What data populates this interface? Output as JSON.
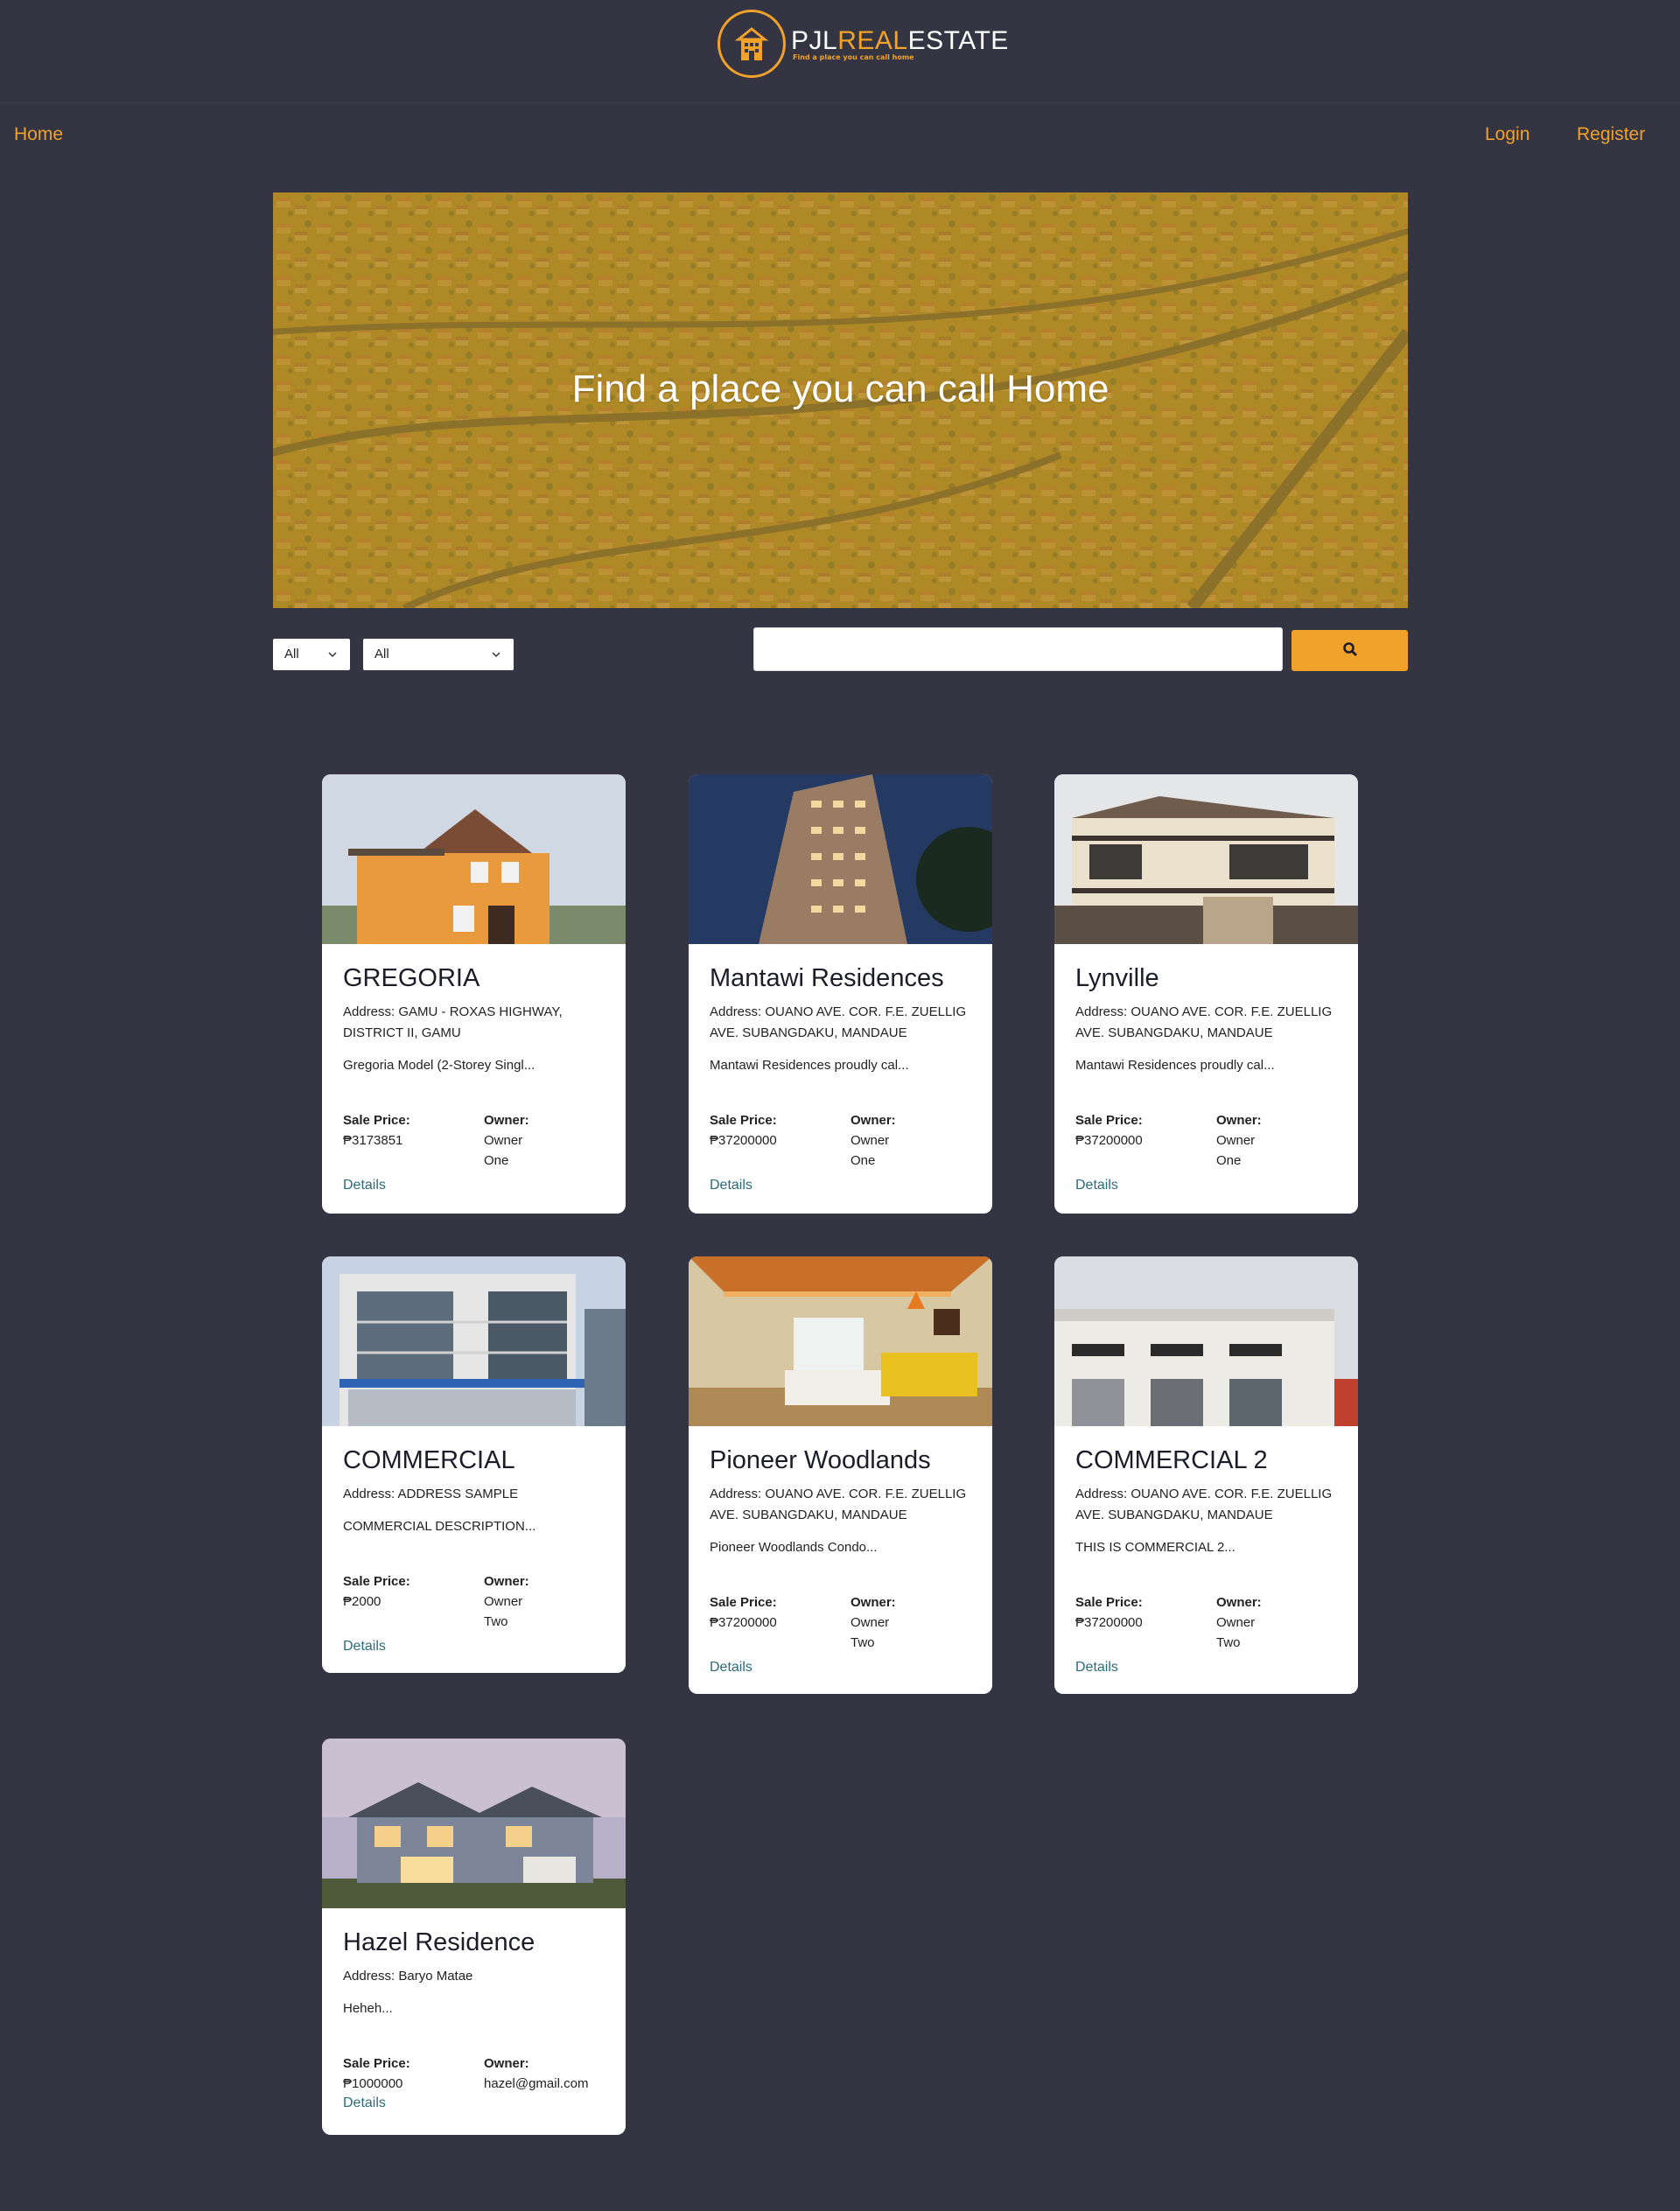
{
  "brand": {
    "name_part1": "PJL",
    "name_part2": "REAL",
    "name_part3": "ESTATE",
    "tagline": "Find a place you can call home",
    "accent_color": "#f0a22a"
  },
  "nav": {
    "home": "Home",
    "login": "Login",
    "register": "Register"
  },
  "hero": {
    "title": "Find a place you can call Home"
  },
  "filters": {
    "type_value": "All",
    "location_value": "All",
    "search_placeholder": "",
    "search_icon": "search-icon"
  },
  "labels": {
    "sale_price": "Sale Price:",
    "owner": "Owner:",
    "details": "Details"
  },
  "listings": [
    {
      "title": "GREGORIA",
      "address": "Address: GAMU - ROXAS HIGHWAY, DISTRICT II, GAMU",
      "description": "Gregoria Model (2-Storey Singl...",
      "price": "₱3173851",
      "owner": "Owner\nOne"
    },
    {
      "title": "Mantawi Residences",
      "address": "Address: OUANO AVE. COR. F.E. ZUELLIG AVE. SUBANGDAKU, MANDAUE",
      "description": "Mantawi Residences proudly cal...",
      "price": "₱37200000",
      "owner": "Owner\nOne"
    },
    {
      "title": "Lynville",
      "address": "Address: OUANO AVE. COR. F.E. ZUELLIG AVE. SUBANGDAKU, MANDAUE",
      "description": "Mantawi Residences proudly cal...",
      "price": "₱37200000",
      "owner": "Owner\nOne"
    },
    {
      "title": "COMMERCIAL",
      "address": "Address: ADDRESS SAMPLE",
      "description": "COMMERCIAL DESCRIPTION...",
      "price": "₱2000",
      "owner": "Owner\nTwo"
    },
    {
      "title": "Pioneer Woodlands",
      "address": "Address: OUANO AVE. COR. F.E. ZUELLIG AVE. SUBANGDAKU, MANDAUE",
      "description": "Pioneer Woodlands Condo...",
      "price": "₱37200000",
      "owner": "Owner\nTwo"
    },
    {
      "title": "COMMERCIAL 2",
      "address": "Address: OUANO AVE. COR. F.E. ZUELLIG AVE. SUBANGDAKU, MANDAUE",
      "description": "THIS IS COMMERCIAL 2...",
      "price": "₱37200000",
      "owner": "Owner\nTwo"
    },
    {
      "title": "Hazel Residence",
      "address": "Address: Baryo Matae",
      "description": "Heheh...",
      "price": "₱1000000",
      "owner": "hazel@gmail.com"
    }
  ]
}
